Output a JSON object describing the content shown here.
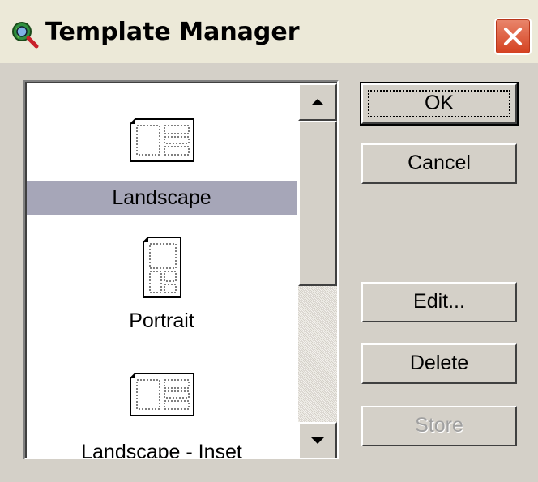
{
  "window": {
    "title": "Template Manager",
    "app_icon": "globe-magnifier-icon",
    "close_icon": "close-icon"
  },
  "templates": {
    "items": [
      {
        "label": "Landscape",
        "icon": "landscape-template-icon",
        "selected": true
      },
      {
        "label": "Portrait",
        "icon": "portrait-template-icon",
        "selected": false
      },
      {
        "label": "Landscape - Inset",
        "icon": "landscape-inset-template-icon",
        "selected": false
      }
    ],
    "selection_color": "#a6a6b8"
  },
  "buttons": {
    "ok": "OK",
    "cancel": "Cancel",
    "edit": "Edit...",
    "delete": "Delete",
    "store": "Store",
    "store_enabled": false
  },
  "colors": {
    "dialog_face": "#d4d0c8",
    "close_button": "#d4401f"
  }
}
